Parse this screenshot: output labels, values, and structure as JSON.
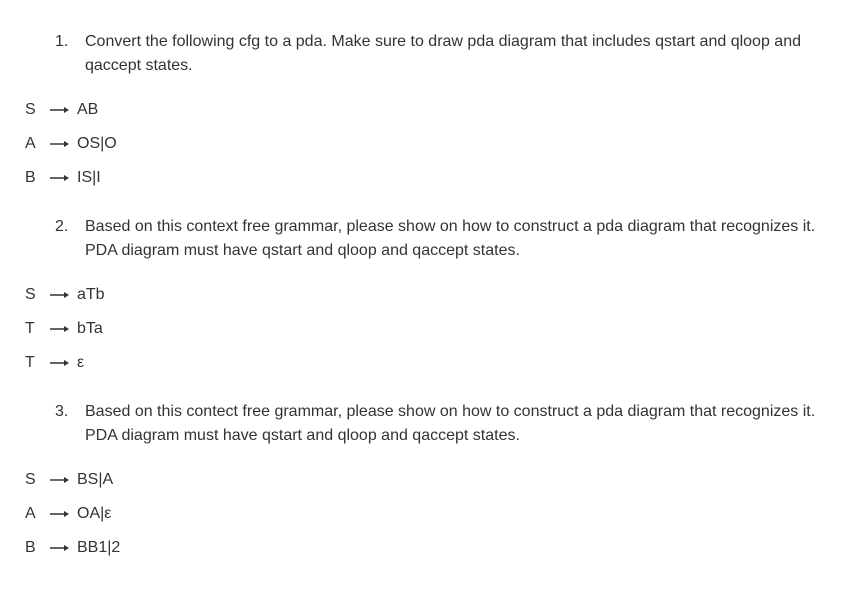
{
  "questions": [
    {
      "number": "1.",
      "text": "Convert the following cfg to a pda. Make sure to draw pda diagram that includes qstart and qloop and qaccept states."
    },
    {
      "number": "2.",
      "text": "Based on this context free grammar, please show on how to construct a pda diagram that recognizes it. PDA diagram must have qstart and qloop and qaccept states."
    },
    {
      "number": "3.",
      "text": "Based on this contect free grammar, please show on how to construct a pda diagram that recognizes it. PDA diagram must have qstart and qloop and qaccept states."
    }
  ],
  "grammars": [
    {
      "productions": [
        {
          "lhs": "S",
          "rhs": "AB"
        },
        {
          "lhs": "A",
          "rhs": "OS|O"
        },
        {
          "lhs": "B",
          "rhs": "IS|I"
        }
      ]
    },
    {
      "productions": [
        {
          "lhs": "S",
          "rhs": "aTb"
        },
        {
          "lhs": "T",
          "rhs": "bTa"
        },
        {
          "lhs": "T",
          "rhs": "ε"
        }
      ]
    },
    {
      "productions": [
        {
          "lhs": "S",
          "rhs": "BS|A"
        },
        {
          "lhs": "A",
          "rhs": "OA|ε"
        },
        {
          "lhs": "B",
          "rhs": "BB1|2"
        }
      ]
    }
  ]
}
